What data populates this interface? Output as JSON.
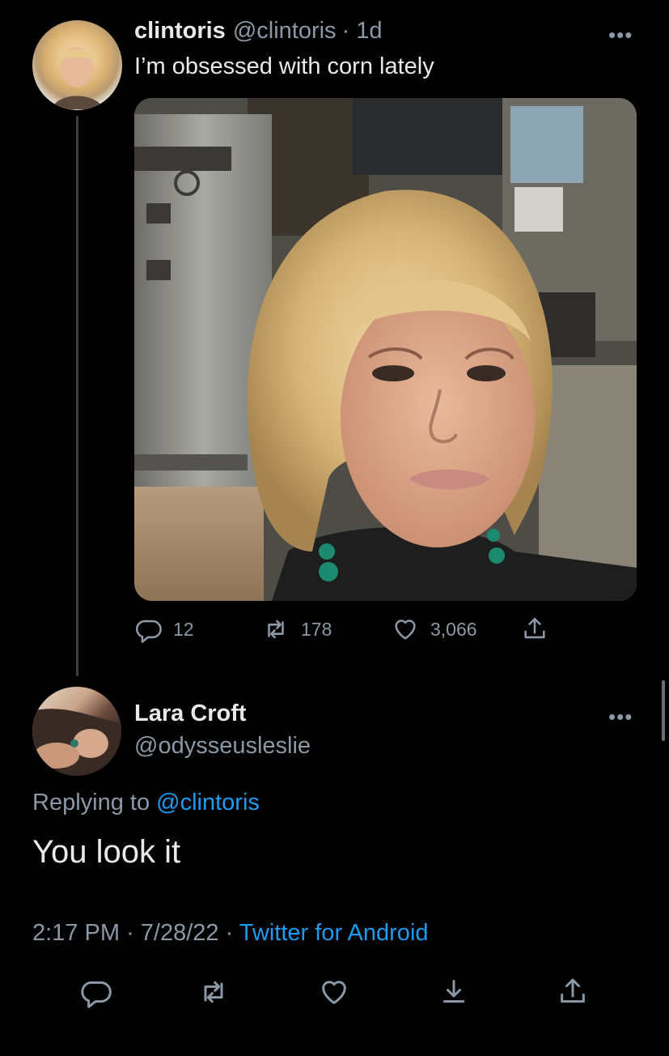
{
  "tweet": {
    "author_name": "clintoris",
    "author_handle": "@clintoris",
    "time_ago": "· 1d",
    "text": "I’m obsessed with corn lately",
    "more_label": "•••",
    "actions": {
      "replies": "12",
      "retweets": "178",
      "likes": "3,066"
    }
  },
  "reply": {
    "author_name": "Lara Croft",
    "author_handle": "@odysseusleslie",
    "more_label": "•••",
    "replying_prefix": "Replying to",
    "replying_to": "@clintoris",
    "text": "You look it",
    "time": "2:17 PM",
    "date": "· 7/28/22 ·",
    "source": "Twitter for Android"
  },
  "colors": {
    "background": "#000000",
    "text": "#e7e9ea",
    "secondary": "#8b98a5",
    "link": "#1d9bf0"
  },
  "icons": [
    "reply-icon",
    "retweet-icon",
    "like-icon",
    "share-icon",
    "bookmark-icon"
  ]
}
